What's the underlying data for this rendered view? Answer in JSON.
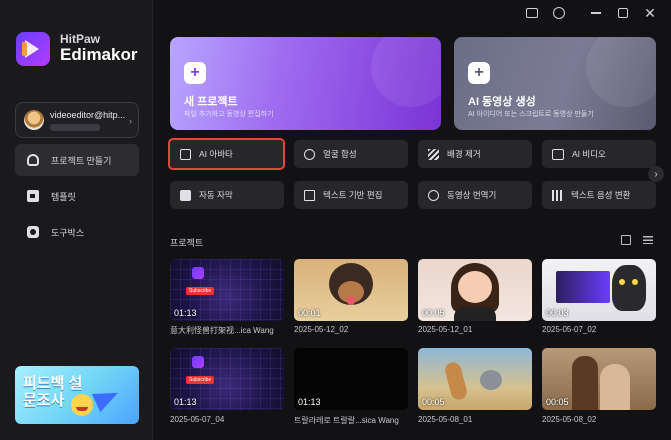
{
  "app": {
    "brand_top": "HitPaw",
    "brand_bottom": "Edimakor"
  },
  "account": {
    "email": "videoeditor@hitp..."
  },
  "sidebar": {
    "items": [
      {
        "label": "프로젝트 만들기",
        "icon": "project-icon",
        "active": true
      },
      {
        "label": "템플릿",
        "icon": "template-icon",
        "active": false
      },
      {
        "label": "도구박스",
        "icon": "toolbox-icon",
        "active": false
      }
    ],
    "survey": {
      "line1": "피드백 설",
      "line2": "문조사"
    }
  },
  "hero": {
    "new_project": {
      "title": "새 프로젝트",
      "subtitle": "파일 추가하고 동영상 편집하기"
    },
    "ai_video": {
      "title": "AI 동영상 생성",
      "subtitle": "AI 아이디어 또는 스크립트로 동영상 만들기"
    }
  },
  "tools": [
    {
      "label": "AI 아바타",
      "icon": "avatar-icon",
      "selected": true
    },
    {
      "label": "얼굴 합성",
      "icon": "face-swap-icon",
      "selected": false
    },
    {
      "label": "배경 제거",
      "icon": "background-remove-icon",
      "selected": false
    },
    {
      "label": "AI 비디오",
      "icon": "video-camera-icon",
      "selected": false
    },
    {
      "label": "자동 자막",
      "icon": "cc-icon",
      "selected": false
    },
    {
      "label": "텍스트 기반 편집",
      "icon": "text-edit-icon",
      "selected": false
    },
    {
      "label": "동영상 번역기",
      "icon": "translate-icon",
      "selected": false
    },
    {
      "label": "텍스트 음성 변환",
      "icon": "tts-icon",
      "selected": false
    }
  ],
  "projects": {
    "heading": "프로젝트",
    "items": [
      {
        "duration": "01:13",
        "name": "意大利怪兽打架视...ica Wang"
      },
      {
        "duration": "00:01",
        "name": "2025-05-12_02"
      },
      {
        "duration": "00:05",
        "name": "2025-05-12_01"
      },
      {
        "duration": "00:03",
        "name": "2025-05-07_02"
      },
      {
        "duration": "01:13",
        "name": "2025-05-07_04"
      },
      {
        "duration": "01:13",
        "name": "트랄라레로 트랄랄...sica Wang"
      },
      {
        "duration": "00:05",
        "name": "2025-05-08_01"
      },
      {
        "duration": "00:05",
        "name": "2025-05-08_02"
      }
    ]
  },
  "colors": {
    "accent_purple": "#7b33d6",
    "selected_border": "#e2463a",
    "background": "#121214"
  }
}
